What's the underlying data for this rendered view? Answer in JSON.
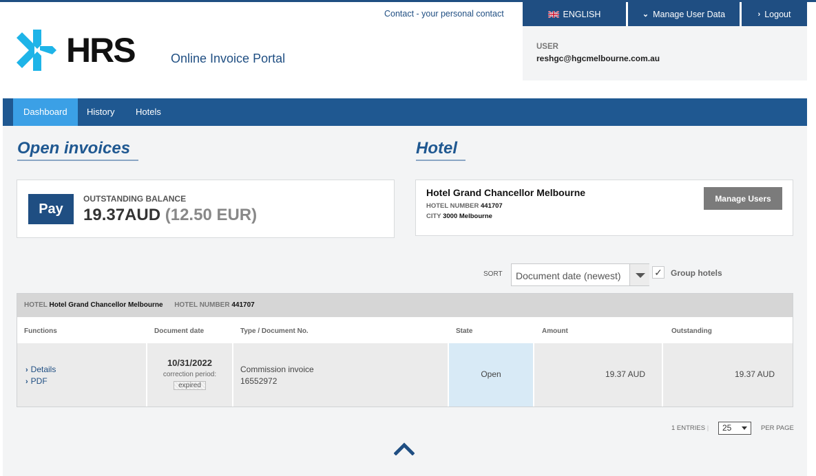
{
  "header": {
    "contact_link": "Contact - your personal contact",
    "language_label": "ENGLISH",
    "manage_user_data_label": "Manage User Data",
    "logout_label": "Logout",
    "user_label": "USER",
    "user_email": "reshgc@hgcmelbourne.com.au",
    "logo_text": "HRS",
    "portal_title": "Online Invoice Portal"
  },
  "nav": {
    "items": [
      {
        "label": "Dashboard",
        "active": true
      },
      {
        "label": "History",
        "active": false
      },
      {
        "label": "Hotels",
        "active": false
      }
    ]
  },
  "open_invoices": {
    "title": "Open invoices",
    "pay_label": "Pay",
    "balance_label": "OUTSTANDING BALANCE",
    "balance_local": "19.37AUD",
    "balance_eur": "(12.50 EUR)"
  },
  "hotel": {
    "title": "Hotel",
    "name": "Hotel Grand Chancellor Melbourne",
    "number_label": "HOTEL NUMBER",
    "number": "441707",
    "city_label": "CITY",
    "city": "3000 Melbourne",
    "manage_users_label": "Manage Users"
  },
  "controls": {
    "sort_label": "SORT",
    "sort_value": "Document date (newest)",
    "group_hotels_label": "Group hotels",
    "group_hotels_checked": true
  },
  "table": {
    "hotel_label": "HOTEL",
    "hotel_name": "Hotel Grand Chancellor Melbourne",
    "hotel_number_label": "HOTEL NUMBER",
    "hotel_number": "441707",
    "columns": [
      "Functions",
      "Document date",
      "Type / Document No.",
      "State",
      "Amount",
      "Outstanding"
    ],
    "rows": [
      {
        "details_label": "Details",
        "pdf_label": "PDF",
        "date": "10/31/2022",
        "correction_label": "correction period:",
        "correction_status": "expired",
        "type": "Commission invoice",
        "doc_no": "16552972",
        "state": "Open",
        "amount": "19.37 AUD",
        "outstanding": "19.37 AUD"
      }
    ]
  },
  "pagination": {
    "entries": "1 ENTRIES",
    "per_page_value": "25",
    "per_page_label": "PER PAGE"
  },
  "colors": {
    "primary": "#1f4e82",
    "nav_bg": "#1f5891",
    "nav_active": "#3ba0e6",
    "logo_accent": "#1eb4e8",
    "state_bg": "#d8eaf6"
  }
}
